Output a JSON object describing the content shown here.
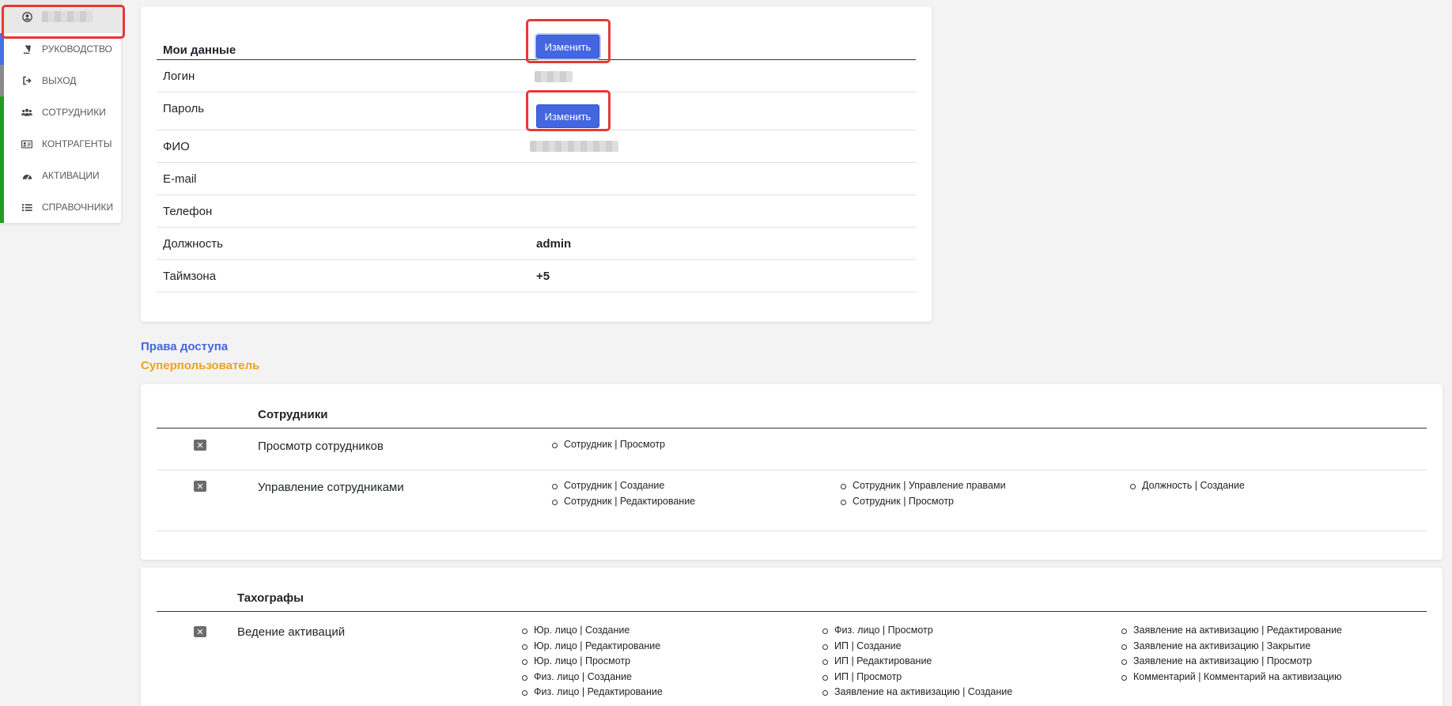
{
  "sidebar": {
    "items": [
      {
        "label": "",
        "icon": "user-icon"
      },
      {
        "label": "РУКОВОДСТВО",
        "icon": "book-icon"
      },
      {
        "label": "ВЫХОД",
        "icon": "sign-out-icon"
      },
      {
        "label": "СОТРУДНИКИ",
        "icon": "users-icon"
      },
      {
        "label": "КОНТРАГЕНТЫ",
        "icon": "id-card-icon"
      },
      {
        "label": "АКТИВАЦИИ",
        "icon": "dashboard-icon"
      },
      {
        "label": "СПРАВОЧНИКИ",
        "icon": "list-icon"
      }
    ]
  },
  "profile": {
    "title": "Мои данные",
    "edit_label": "Изменить",
    "login_label": "Логин",
    "password_label": "Пароль",
    "password_button": "Изменить",
    "fio_label": "ФИО",
    "email_label": "E-mail",
    "phone_label": "Телефон",
    "position_label": "Должность",
    "position_value": "admin",
    "timezone_label": "Таймзона",
    "timezone_value": "+5"
  },
  "access": {
    "title": "Права доступа",
    "role": "Суперпользователь"
  },
  "sections": [
    {
      "title": "Сотрудники",
      "rows": [
        {
          "name": "Просмотр сотрудников",
          "cols": [
            [
              "Сотрудник | Просмотр"
            ]
          ]
        },
        {
          "name": "Управление сотрудниками",
          "cols": [
            [
              "Сотрудник | Создание",
              "Сотрудник | Редактирование"
            ],
            [
              "Сотрудник | Управление правами",
              "Сотрудник | Просмотр"
            ],
            [
              "Должность | Создание"
            ]
          ]
        }
      ]
    },
    {
      "title": "Тахографы",
      "rows": [
        {
          "name": "Ведение активаций",
          "cols": [
            [
              "Юр. лицо | Создание",
              "Юр. лицо | Редактирование",
              "Юр. лицо | Просмотр",
              "Физ. лицо | Создание",
              "Физ. лицо | Редактирование"
            ],
            [
              "Физ. лицо | Просмотр",
              "ИП | Создание",
              "ИП | Редактирование",
              "ИП | Просмотр",
              "Заявление на активизацию | Создание"
            ],
            [
              "Заявление на активизацию | Редактирование",
              "Заявление на активизацию | Закрытие",
              "Заявление на активизацию | Просмотр",
              "Комментарий | Комментарий на активизацию"
            ]
          ]
        }
      ]
    }
  ]
}
